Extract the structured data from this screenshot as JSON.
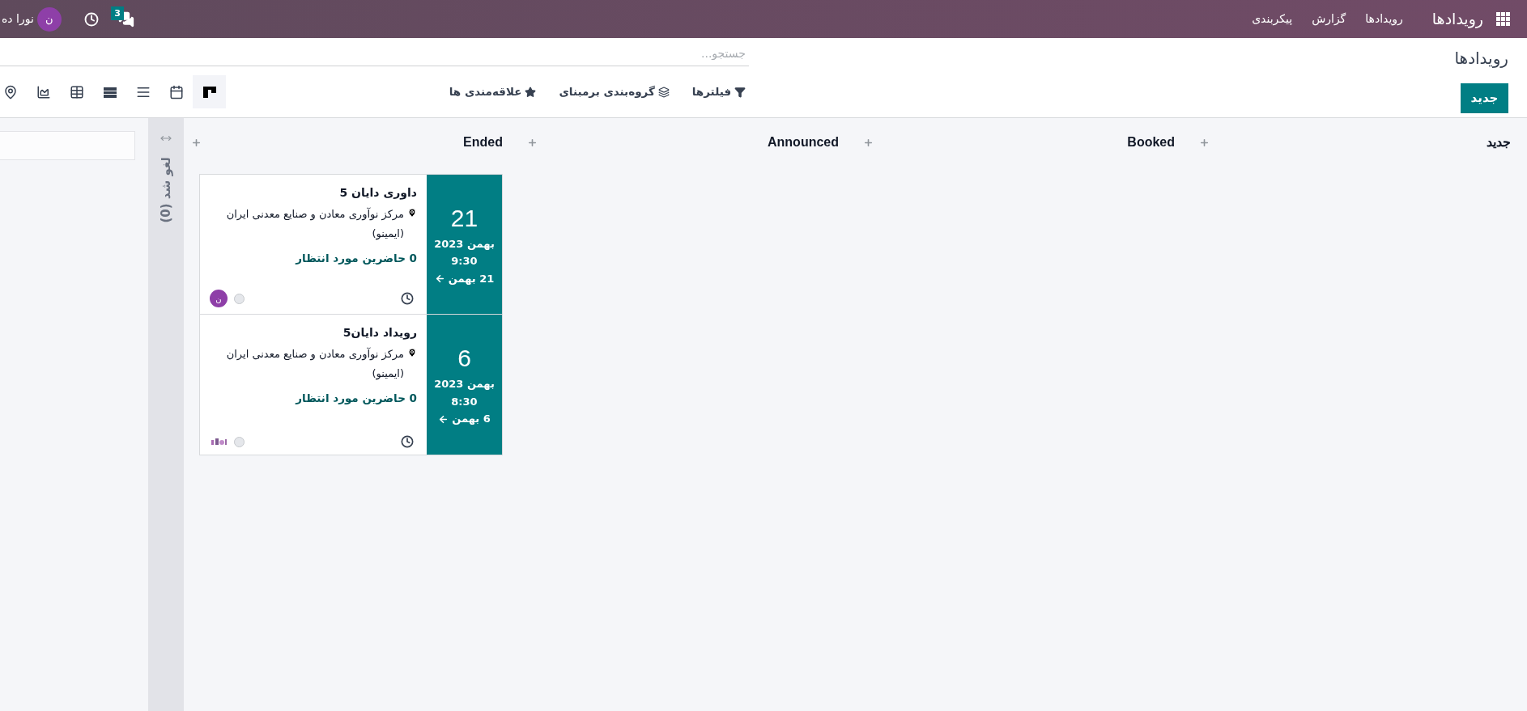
{
  "navbar": {
    "app_name": "رویدادها",
    "menu": [
      "رویدادها",
      "گزارش",
      "پیکربندی"
    ],
    "messages_badge": "3",
    "user_initial": "ن",
    "user_name": "نورا ده"
  },
  "control_panel": {
    "breadcrumb": "رویدادها",
    "new_button": "جدید",
    "search": {
      "placeholder": "جستجو..."
    },
    "search_options": [
      {
        "kind": "filter",
        "label": "فیلترها"
      },
      {
        "kind": "group",
        "label": "گروه‌بندی برمبنای"
      },
      {
        "kind": "favorite",
        "label": "علاقه‌مندی ها"
      }
    ],
    "views": [
      {
        "kind": "kanban",
        "selected": true
      },
      {
        "kind": "calendar",
        "selected": false
      },
      {
        "kind": "list",
        "selected": false
      },
      {
        "kind": "gantt",
        "selected": false
      },
      {
        "kind": "pivot",
        "selected": false
      },
      {
        "kind": "graph",
        "selected": false
      },
      {
        "kind": "map",
        "selected": false
      }
    ]
  },
  "kanban": {
    "columns": [
      {
        "title": "جدید"
      },
      {
        "title": "Booked"
      },
      {
        "title": "Announced"
      },
      {
        "title": "Ended",
        "cards": [
          {
            "day": "21",
            "month_year": "بهمن 2023",
            "time": "9:30",
            "end": "21 بهمن",
            "name": "داوری دایان 5",
            "location": "مرکز نوآوری معادن و صنایع معدنی ایران (ایمینو)",
            "attendees": "0 حاضرین مورد انتظار",
            "assignee": {
              "kind": "avatar",
              "initial": "ن"
            }
          },
          {
            "day": "6",
            "month_year": "بهمن 2023",
            "time": "8:30",
            "end": "6 بهمن",
            "name": "رویداد دایان5",
            "location": "مرکز نوآوری معادن و صنایع معدنی ایران (ایمینو)",
            "attendees": "0 حاضرین مورد انتظار"
          }
        ]
      }
    ],
    "folded_columns": [
      {
        "title": "لغو شد (0)"
      }
    ]
  }
}
